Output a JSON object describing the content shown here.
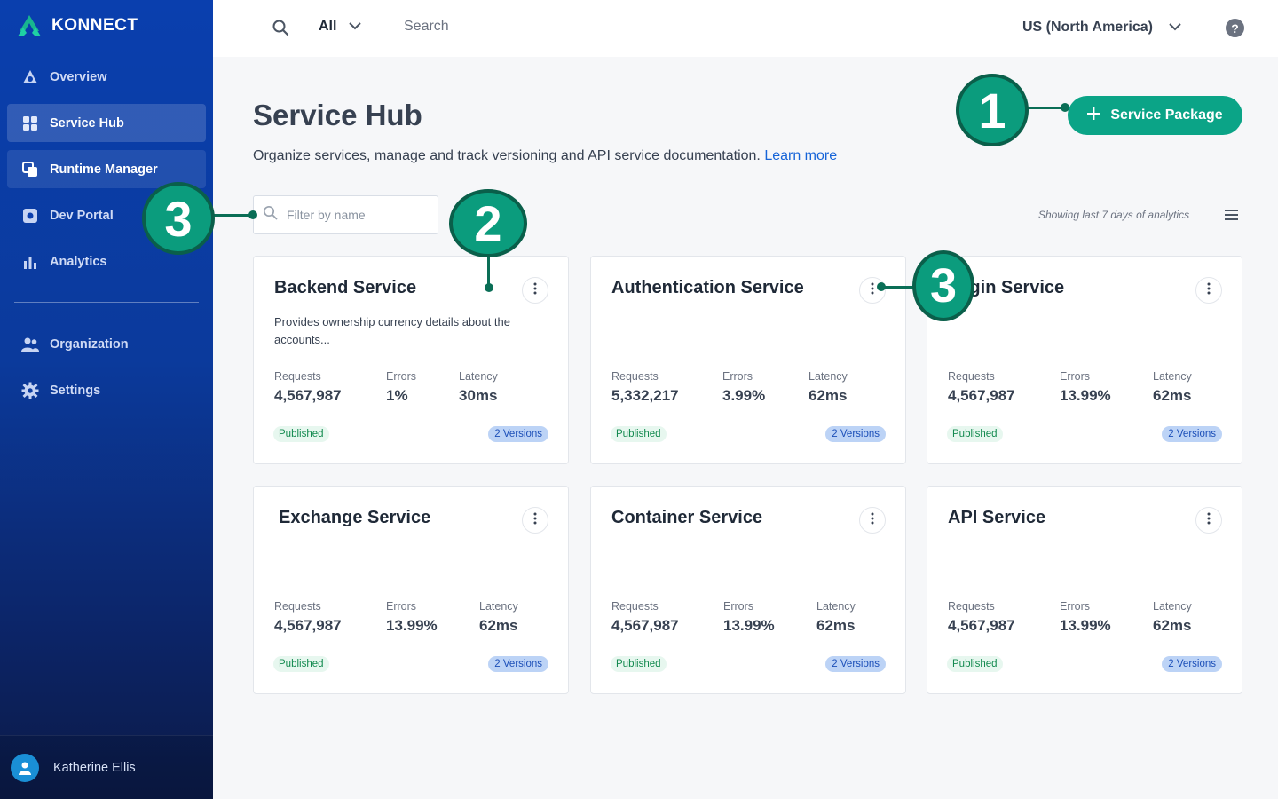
{
  "sidebar": {
    "logo_text": "KONNECT",
    "items": [
      {
        "label": "Overview",
        "icon": "overview-icon"
      },
      {
        "label": "Service Hub",
        "icon": "grid-icon"
      },
      {
        "label": "Runtime Manager",
        "icon": "layers-icon"
      },
      {
        "label": "Dev Portal",
        "icon": "portal-icon"
      },
      {
        "label": "Analytics",
        "icon": "bar-chart-icon"
      }
    ],
    "secondary": [
      {
        "label": "Organization",
        "icon": "people-icon"
      },
      {
        "label": "Settings",
        "icon": "gear-icon"
      }
    ],
    "user_name": "Katherine Ellis"
  },
  "topbar": {
    "scope": "All",
    "search_placeholder": "Search",
    "region": "US (North America)",
    "help": "?"
  },
  "main": {
    "title": "Service Hub",
    "description": "Organize services, manage and track versioning and API service documentation.",
    "learn_more": "Learn more",
    "primary_button": "Service Package",
    "filter_placeholder": "Filter by name",
    "analytics_note": "Showing last 7 days of analytics"
  },
  "cards": [
    {
      "title": "Backend Service",
      "description": "Provides ownership currency details about the accounts...",
      "requests_label": "Requests",
      "requests": "4,567,987",
      "errors_label": "Errors",
      "errors": "1%",
      "latency_label": "Latency",
      "latency": "30ms",
      "status": "Published",
      "versions": "2 Versions"
    },
    {
      "title": "Authentication Service",
      "description": "",
      "requests_label": "Requests",
      "requests": "5,332,217",
      "errors_label": "Errors",
      "errors": "3.99%",
      "latency_label": "Latency",
      "latency": "62ms",
      "status": "Published",
      "versions": "2 Versions"
    },
    {
      "title": "Login Service",
      "description": "",
      "requests_label": "Requests",
      "requests": "4,567,987",
      "errors_label": "Errors",
      "errors": "13.99%",
      "latency_label": "Latency",
      "latency": "62ms",
      "status": "Published",
      "versions": "2 Versions"
    },
    {
      "title": "Exchange Service",
      "description": "",
      "requests_label": "Requests",
      "requests": "4,567,987",
      "errors_label": "Errors",
      "errors": "13.99%",
      "latency_label": "Latency",
      "latency": "62ms",
      "status": "Published",
      "versions": "2 Versions"
    },
    {
      "title": "Container Service",
      "description": "",
      "requests_label": "Requests",
      "requests": "4,567,987",
      "errors_label": "Errors",
      "errors": "13.99%",
      "latency_label": "Latency",
      "latency": "62ms",
      "status": "Published",
      "versions": "2 Versions"
    },
    {
      "title": "API Service",
      "description": "",
      "requests_label": "Requests",
      "requests": "4,567,987",
      "errors_label": "Errors",
      "errors": "13.99%",
      "latency_label": "Latency",
      "latency": "62ms",
      "status": "Published",
      "versions": "2 Versions"
    }
  ],
  "callouts": [
    "1",
    "2",
    "3",
    "3"
  ],
  "colors": {
    "accent": "#0ba487",
    "sidebar": "#0a3fae",
    "link": "#1664d8",
    "callout": "#0b9c7d"
  }
}
